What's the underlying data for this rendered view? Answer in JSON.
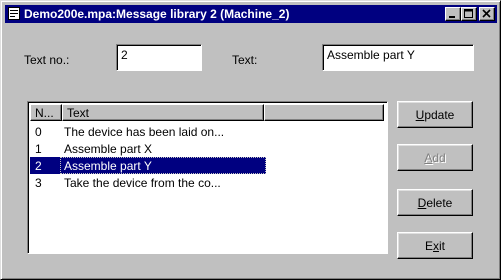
{
  "window": {
    "title": "Demo200e.mpa:Message library 2 (Machine_2)"
  },
  "form": {
    "text_no_label": "Text no.:",
    "text_no_value": "2",
    "text_label": "Text:",
    "text_value": "Assemble part Y"
  },
  "list": {
    "columns": [
      {
        "label": "N..."
      },
      {
        "label": "Text"
      },
      {
        "label": ""
      }
    ],
    "rows": [
      {
        "no": "0",
        "text": "The device has been laid on...",
        "selected": false
      },
      {
        "no": "1",
        "text": "Assemble part X",
        "selected": false
      },
      {
        "no": "2",
        "text": "Assemble part Y",
        "selected": true
      },
      {
        "no": "3",
        "text": "Take the device from the co...",
        "selected": false
      }
    ]
  },
  "buttons": {
    "update": {
      "pre": "",
      "key": "U",
      "post": "pdate",
      "enabled": true
    },
    "add": {
      "pre": "",
      "key": "A",
      "post": "dd",
      "enabled": false
    },
    "delete": {
      "pre": "",
      "key": "D",
      "post": "elete",
      "enabled": true
    },
    "exit": {
      "pre": "E",
      "key": "x",
      "post": "it",
      "enabled": true
    }
  },
  "icons": {
    "app": "document-icon",
    "minimize": "minimize-icon",
    "maximize": "maximize-icon",
    "close": "close-icon"
  },
  "colors": {
    "titlebar": "#000080",
    "selection": "#000080",
    "face": "#c0c0c0"
  }
}
